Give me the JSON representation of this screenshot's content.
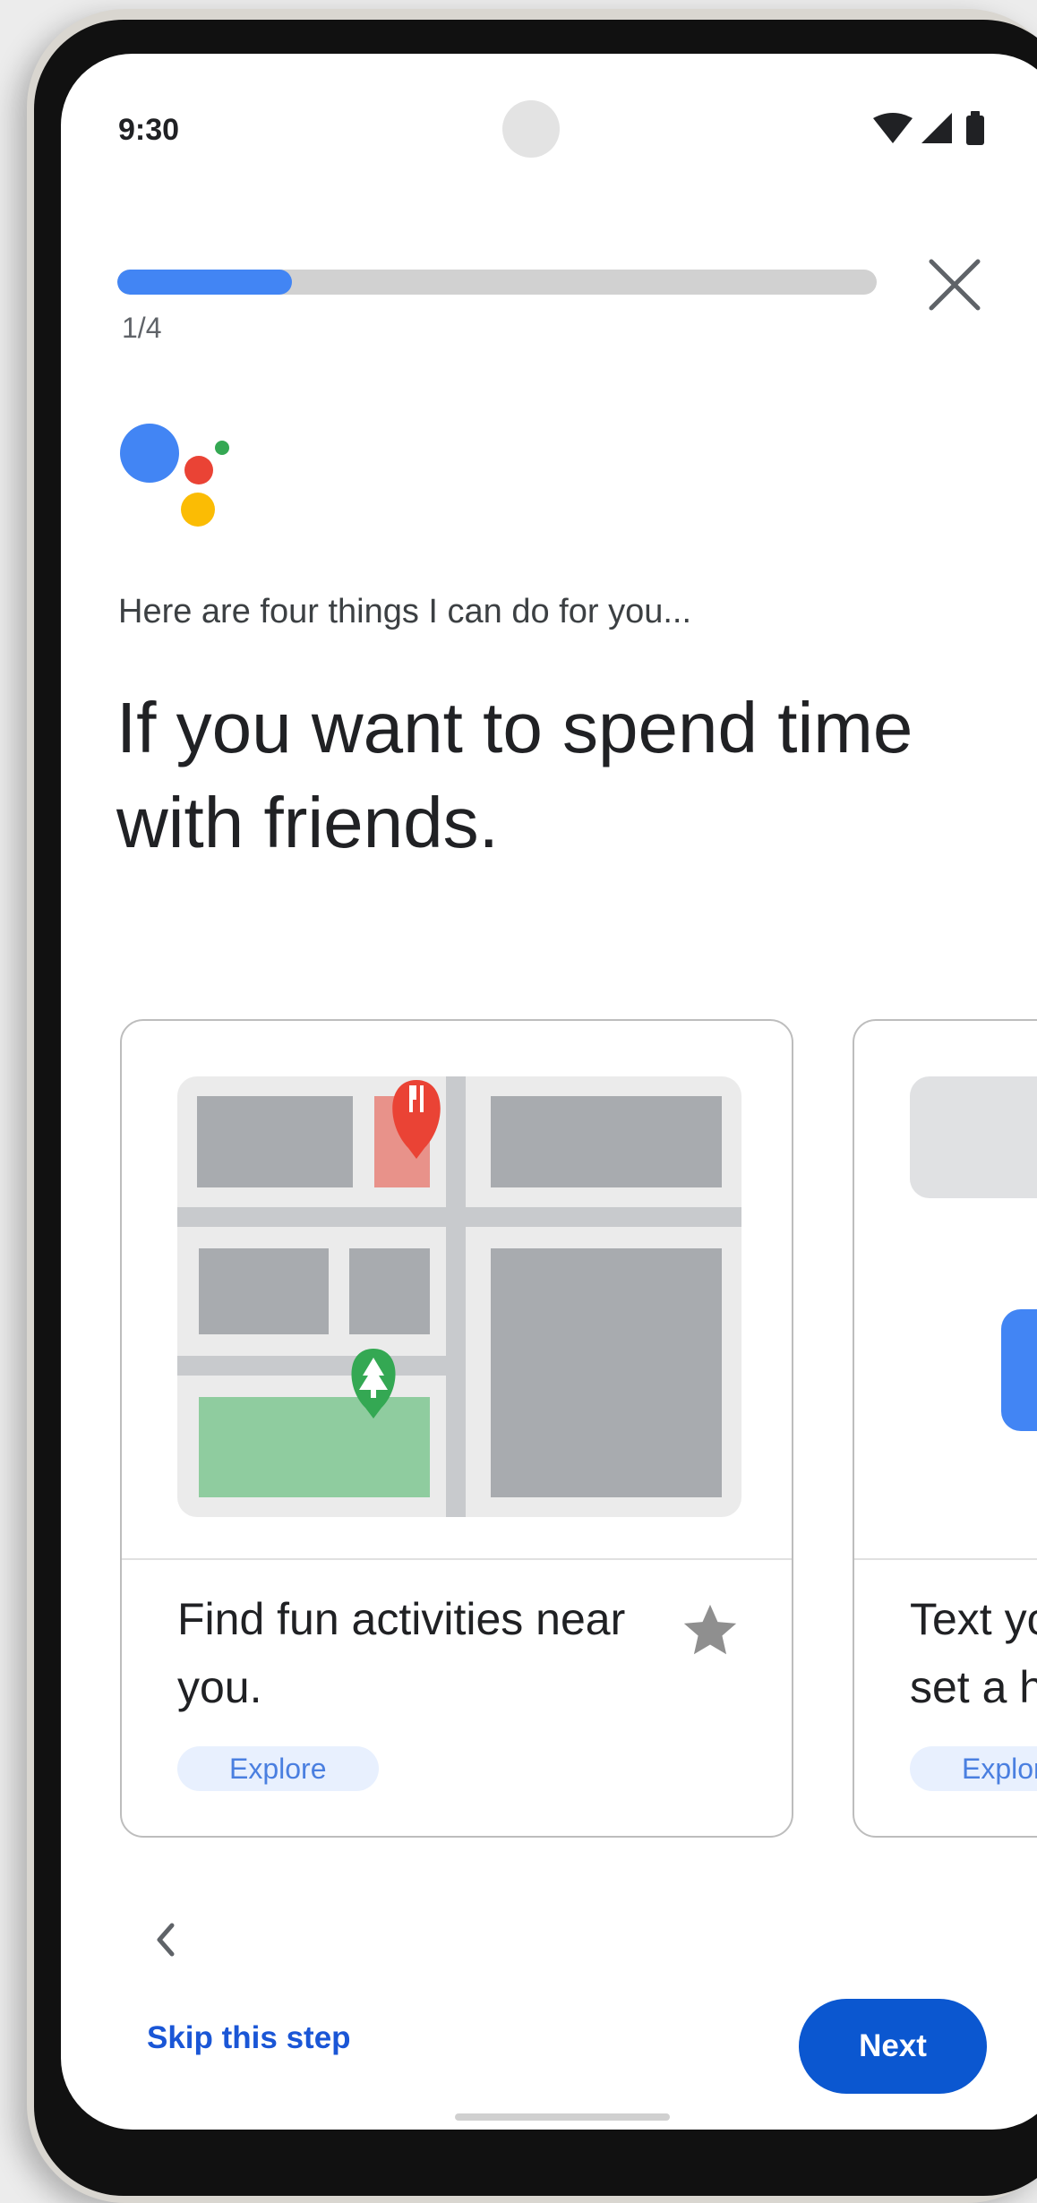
{
  "status_bar": {
    "time": "9:30"
  },
  "progress": {
    "fraction": 0.23,
    "step_label": "1/4"
  },
  "intro": {
    "subtitle": "Here are four things I can do for you...",
    "headline": "If you want to spend time with friends."
  },
  "cards": [
    {
      "title": "Find fun activities near you.",
      "chip": "Explore",
      "starred": false
    },
    {
      "title": "Text your friends and set a h",
      "chip": "Explore"
    }
  ],
  "footer": {
    "skip_label": "Skip this step",
    "next_label": "Next"
  },
  "colors": {
    "accent_blue": "#4285f4",
    "button_blue": "#0b57d0",
    "link_blue": "#1a56d6",
    "google_red": "#ea4335",
    "google_yellow": "#fbbc04",
    "google_green": "#34a853"
  },
  "icons": [
    "wifi-icon",
    "cellular-signal-icon",
    "battery-icon",
    "close-icon",
    "assistant-logo-icon",
    "restaurant-pin-icon",
    "park-pin-icon",
    "star-icon",
    "chevron-left-icon"
  ]
}
